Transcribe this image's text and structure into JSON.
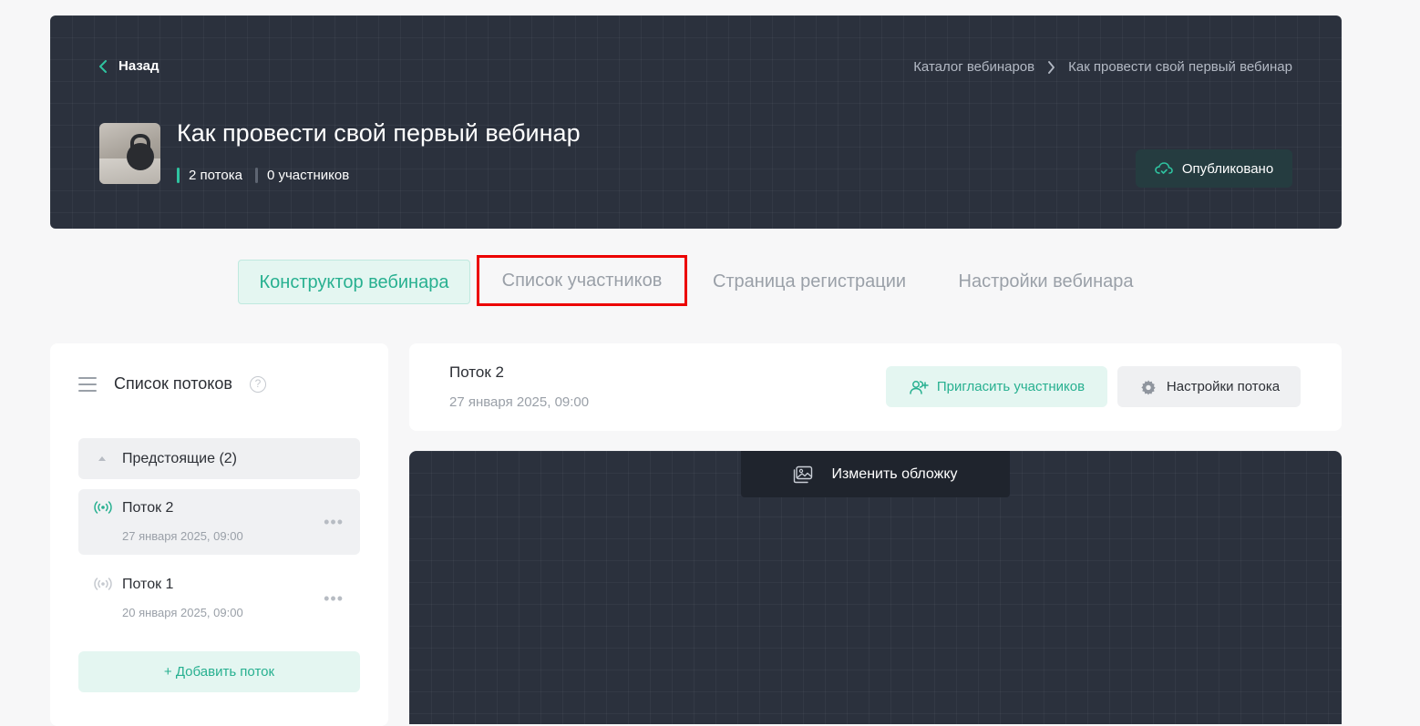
{
  "header": {
    "back_label": "Назад",
    "breadcrumbs": [
      "Каталог вебинаров",
      "Как провести свой первый вебинар"
    ],
    "title": "Как провести свой первый вебинар",
    "streams_count": "2 потока",
    "participants_count": "0 участников",
    "status_label": "Опубликовано"
  },
  "tabs": [
    {
      "label": "Конструктор вебинара",
      "active": true
    },
    {
      "label": "Список участников",
      "active": false
    },
    {
      "label": "Страница регистрации",
      "active": false
    },
    {
      "label": "Настройки вебинара",
      "active": false
    }
  ],
  "sidebar": {
    "title": "Список потоков",
    "help_glyph": "?",
    "group_label": "Предстоящие (2)",
    "streams": [
      {
        "name": "Поток 2",
        "date": "27 января 2025, 09:00",
        "selected": true
      },
      {
        "name": "Поток 1",
        "date": "20 января 2025, 09:00",
        "selected": false
      }
    ],
    "add_label": "+ Добавить поток"
  },
  "stream_header": {
    "name": "Поток 2",
    "date": "27 января 2025, 09:00",
    "invite_label": "Пригласить участников",
    "settings_label": "Настройки потока"
  },
  "cover": {
    "change_label": "Изменить обложку"
  },
  "colors": {
    "accent": "#27b090",
    "dark_bg": "#2b313d",
    "highlight": "#ec0000"
  }
}
